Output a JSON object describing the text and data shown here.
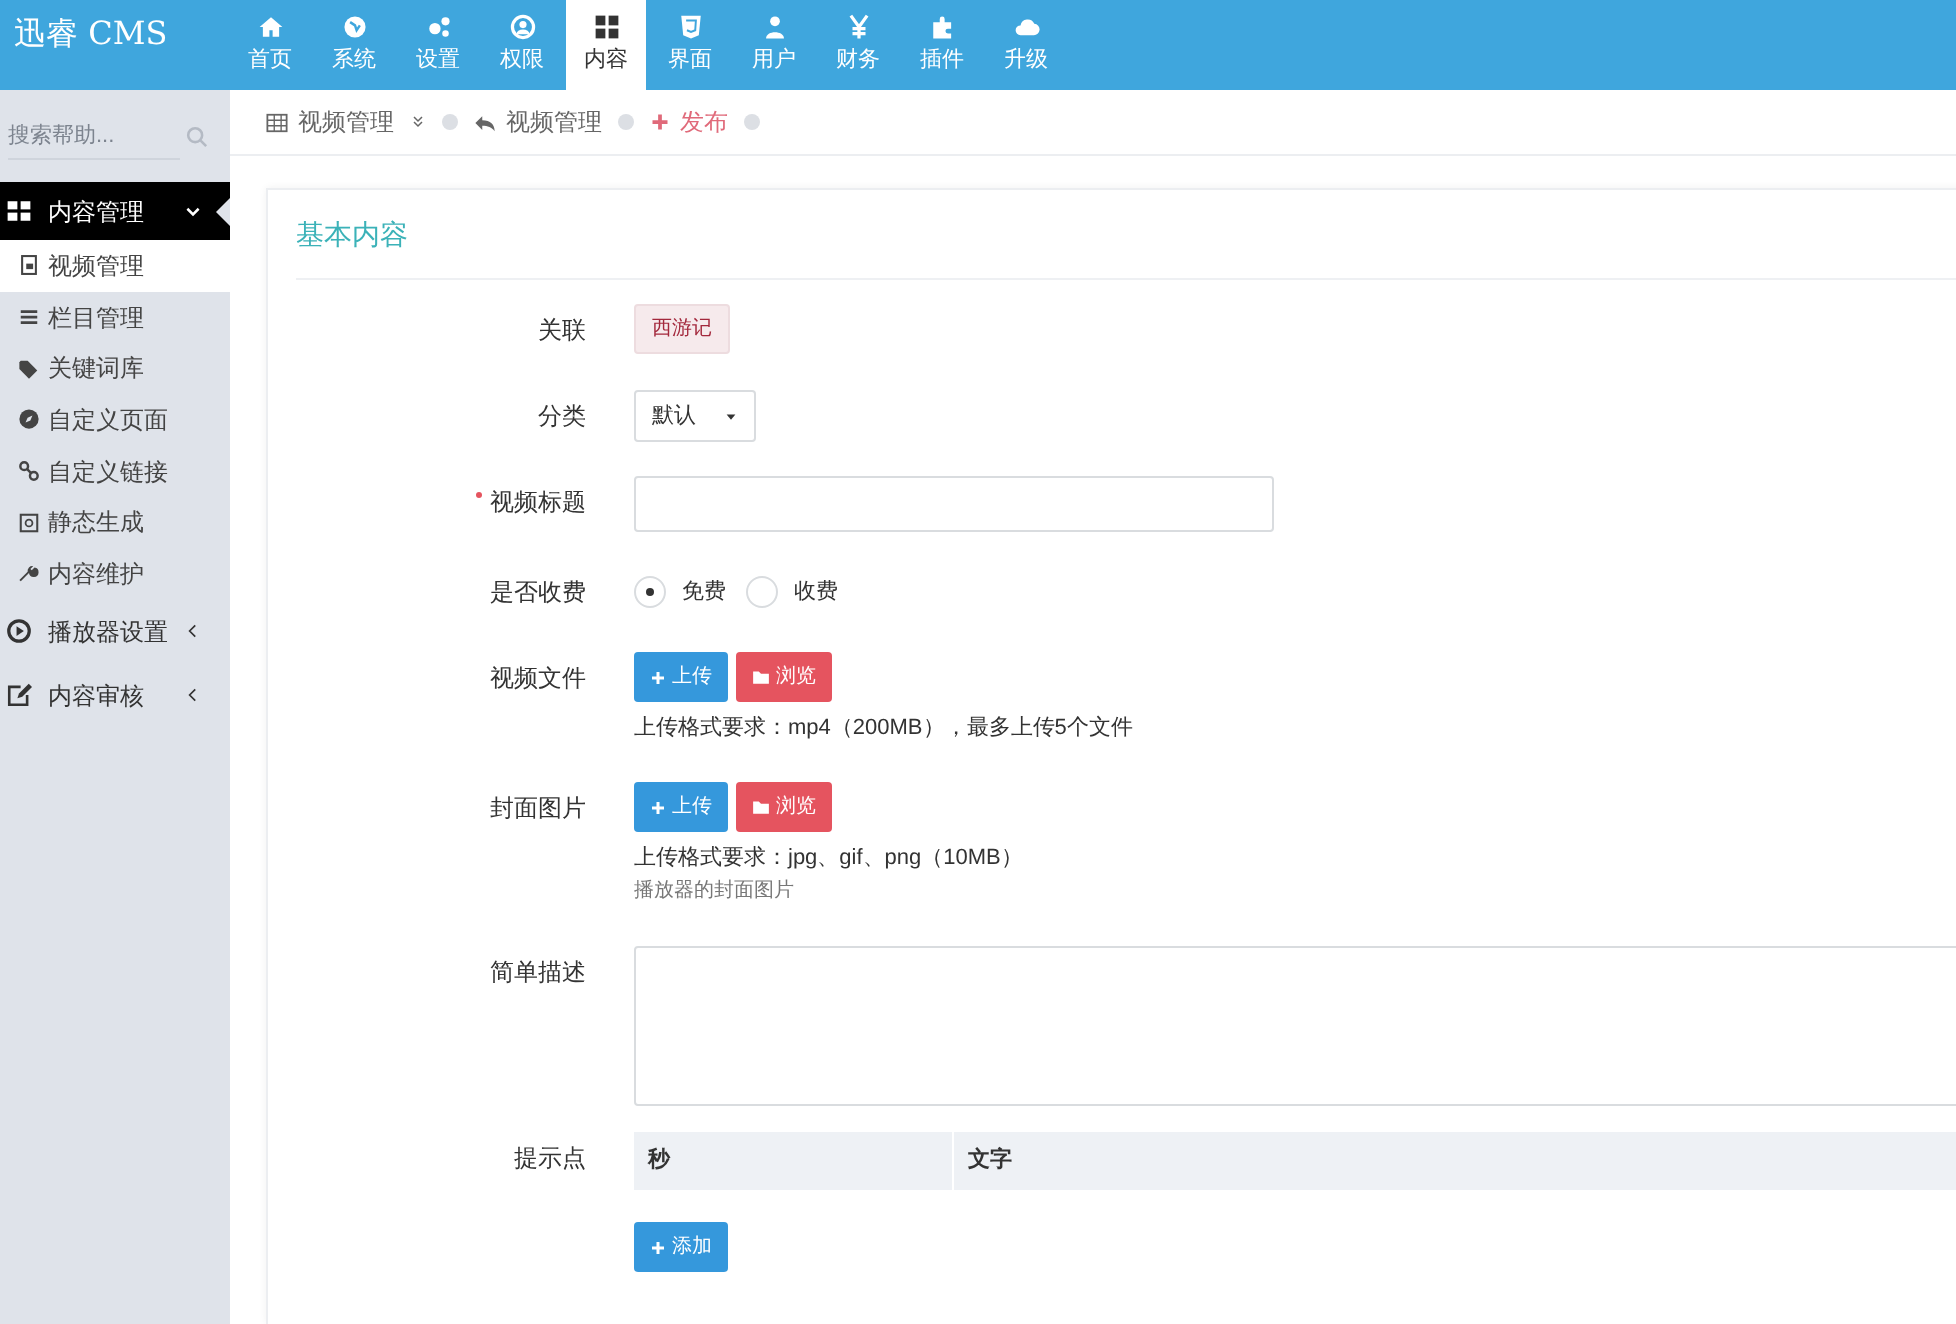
{
  "brand": "迅睿 CMS",
  "top_nav": [
    {
      "label": "首页",
      "selected": false
    },
    {
      "label": "系统",
      "selected": false
    },
    {
      "label": "设置",
      "selected": false
    },
    {
      "label": "权限",
      "selected": false
    },
    {
      "label": "内容",
      "selected": true
    },
    {
      "label": "界面",
      "selected": false
    },
    {
      "label": "用户",
      "selected": false
    },
    {
      "label": "财务",
      "selected": false
    },
    {
      "label": "插件",
      "selected": false
    },
    {
      "label": "升级",
      "selected": false
    }
  ],
  "sidebar": {
    "search": {
      "placeholder": "搜索帮助..."
    },
    "menu": [
      {
        "label": "内容管理",
        "expanded": true,
        "children": [
          {
            "label": "视频管理",
            "selected": true
          },
          {
            "label": "栏目管理",
            "selected": false
          },
          {
            "label": "关键词库",
            "selected": false
          },
          {
            "label": "自定义页面",
            "selected": false
          },
          {
            "label": "自定义链接",
            "selected": false
          },
          {
            "label": "静态生成",
            "selected": false
          },
          {
            "label": "内容维护",
            "selected": false
          }
        ]
      },
      {
        "label": "播放器设置",
        "expanded": false
      },
      {
        "label": "内容审核",
        "expanded": false
      }
    ]
  },
  "breadcrumb": [
    {
      "label": "视频管理",
      "kind": "menu"
    },
    {
      "label": "视频管理",
      "kind": "back"
    },
    {
      "label": "发布",
      "kind": "add"
    }
  ],
  "section_title": "基本内容",
  "fields": [
    {
      "kind": "tag",
      "label": "关联",
      "value": "西游记"
    },
    {
      "kind": "select",
      "label": "分类",
      "value": "默认"
    },
    {
      "kind": "text",
      "label": "视频标题",
      "required": true
    },
    {
      "kind": "radio",
      "label": "是否收费",
      "options": [
        {
          "label": "免费",
          "selected": true
        },
        {
          "label": "收费",
          "selected": false
        }
      ]
    },
    {
      "kind": "upload",
      "label": "视频文件",
      "buttons": [
        "上传",
        "浏览"
      ],
      "hints": [
        "上传格式要求：mp4（200MB），最多上传5个文件"
      ]
    },
    {
      "kind": "upload",
      "label": "封面图片",
      "buttons": [
        "上传",
        "浏览"
      ],
      "hints": [
        "上传格式要求：jpg、gif、png（10MB）",
        "播放器的封面图片"
      ]
    },
    {
      "kind": "textarea",
      "label": "简单描述"
    },
    {
      "kind": "table",
      "label": "提示点",
      "columns": [
        "秒",
        "文字"
      ],
      "add_button": "添加"
    }
  ]
}
